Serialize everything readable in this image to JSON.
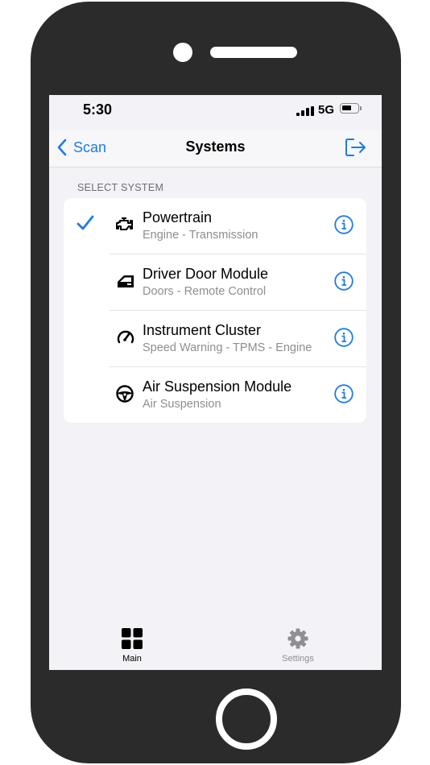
{
  "status": {
    "time": "5:30",
    "network": "5G"
  },
  "nav": {
    "back_label": "Scan",
    "title": "Systems"
  },
  "section_header": "SELECT SYSTEM",
  "systems": [
    {
      "title": "Powertrain",
      "subtitle": "Engine - Transmission",
      "selected": true,
      "icon": "engine-icon"
    },
    {
      "title": "Driver Door Module",
      "subtitle": "Doors - Remote Control",
      "selected": false,
      "icon": "car-door-icon"
    },
    {
      "title": "Instrument Cluster",
      "subtitle": "Speed Warning - TPMS - Engine",
      "selected": false,
      "icon": "speedometer-icon"
    },
    {
      "title": "Air Suspension Module",
      "subtitle": "Air Suspension",
      "selected": false,
      "icon": "steering-wheel-icon"
    }
  ],
  "tabs": [
    {
      "label": "Main",
      "icon": "grid-icon",
      "active": true
    },
    {
      "label": "Settings",
      "icon": "gear-icon",
      "active": false
    }
  ],
  "colors": {
    "accent": "#1c7ce0",
    "background": "#f2f2f7",
    "inactive": "#8e8e93"
  }
}
